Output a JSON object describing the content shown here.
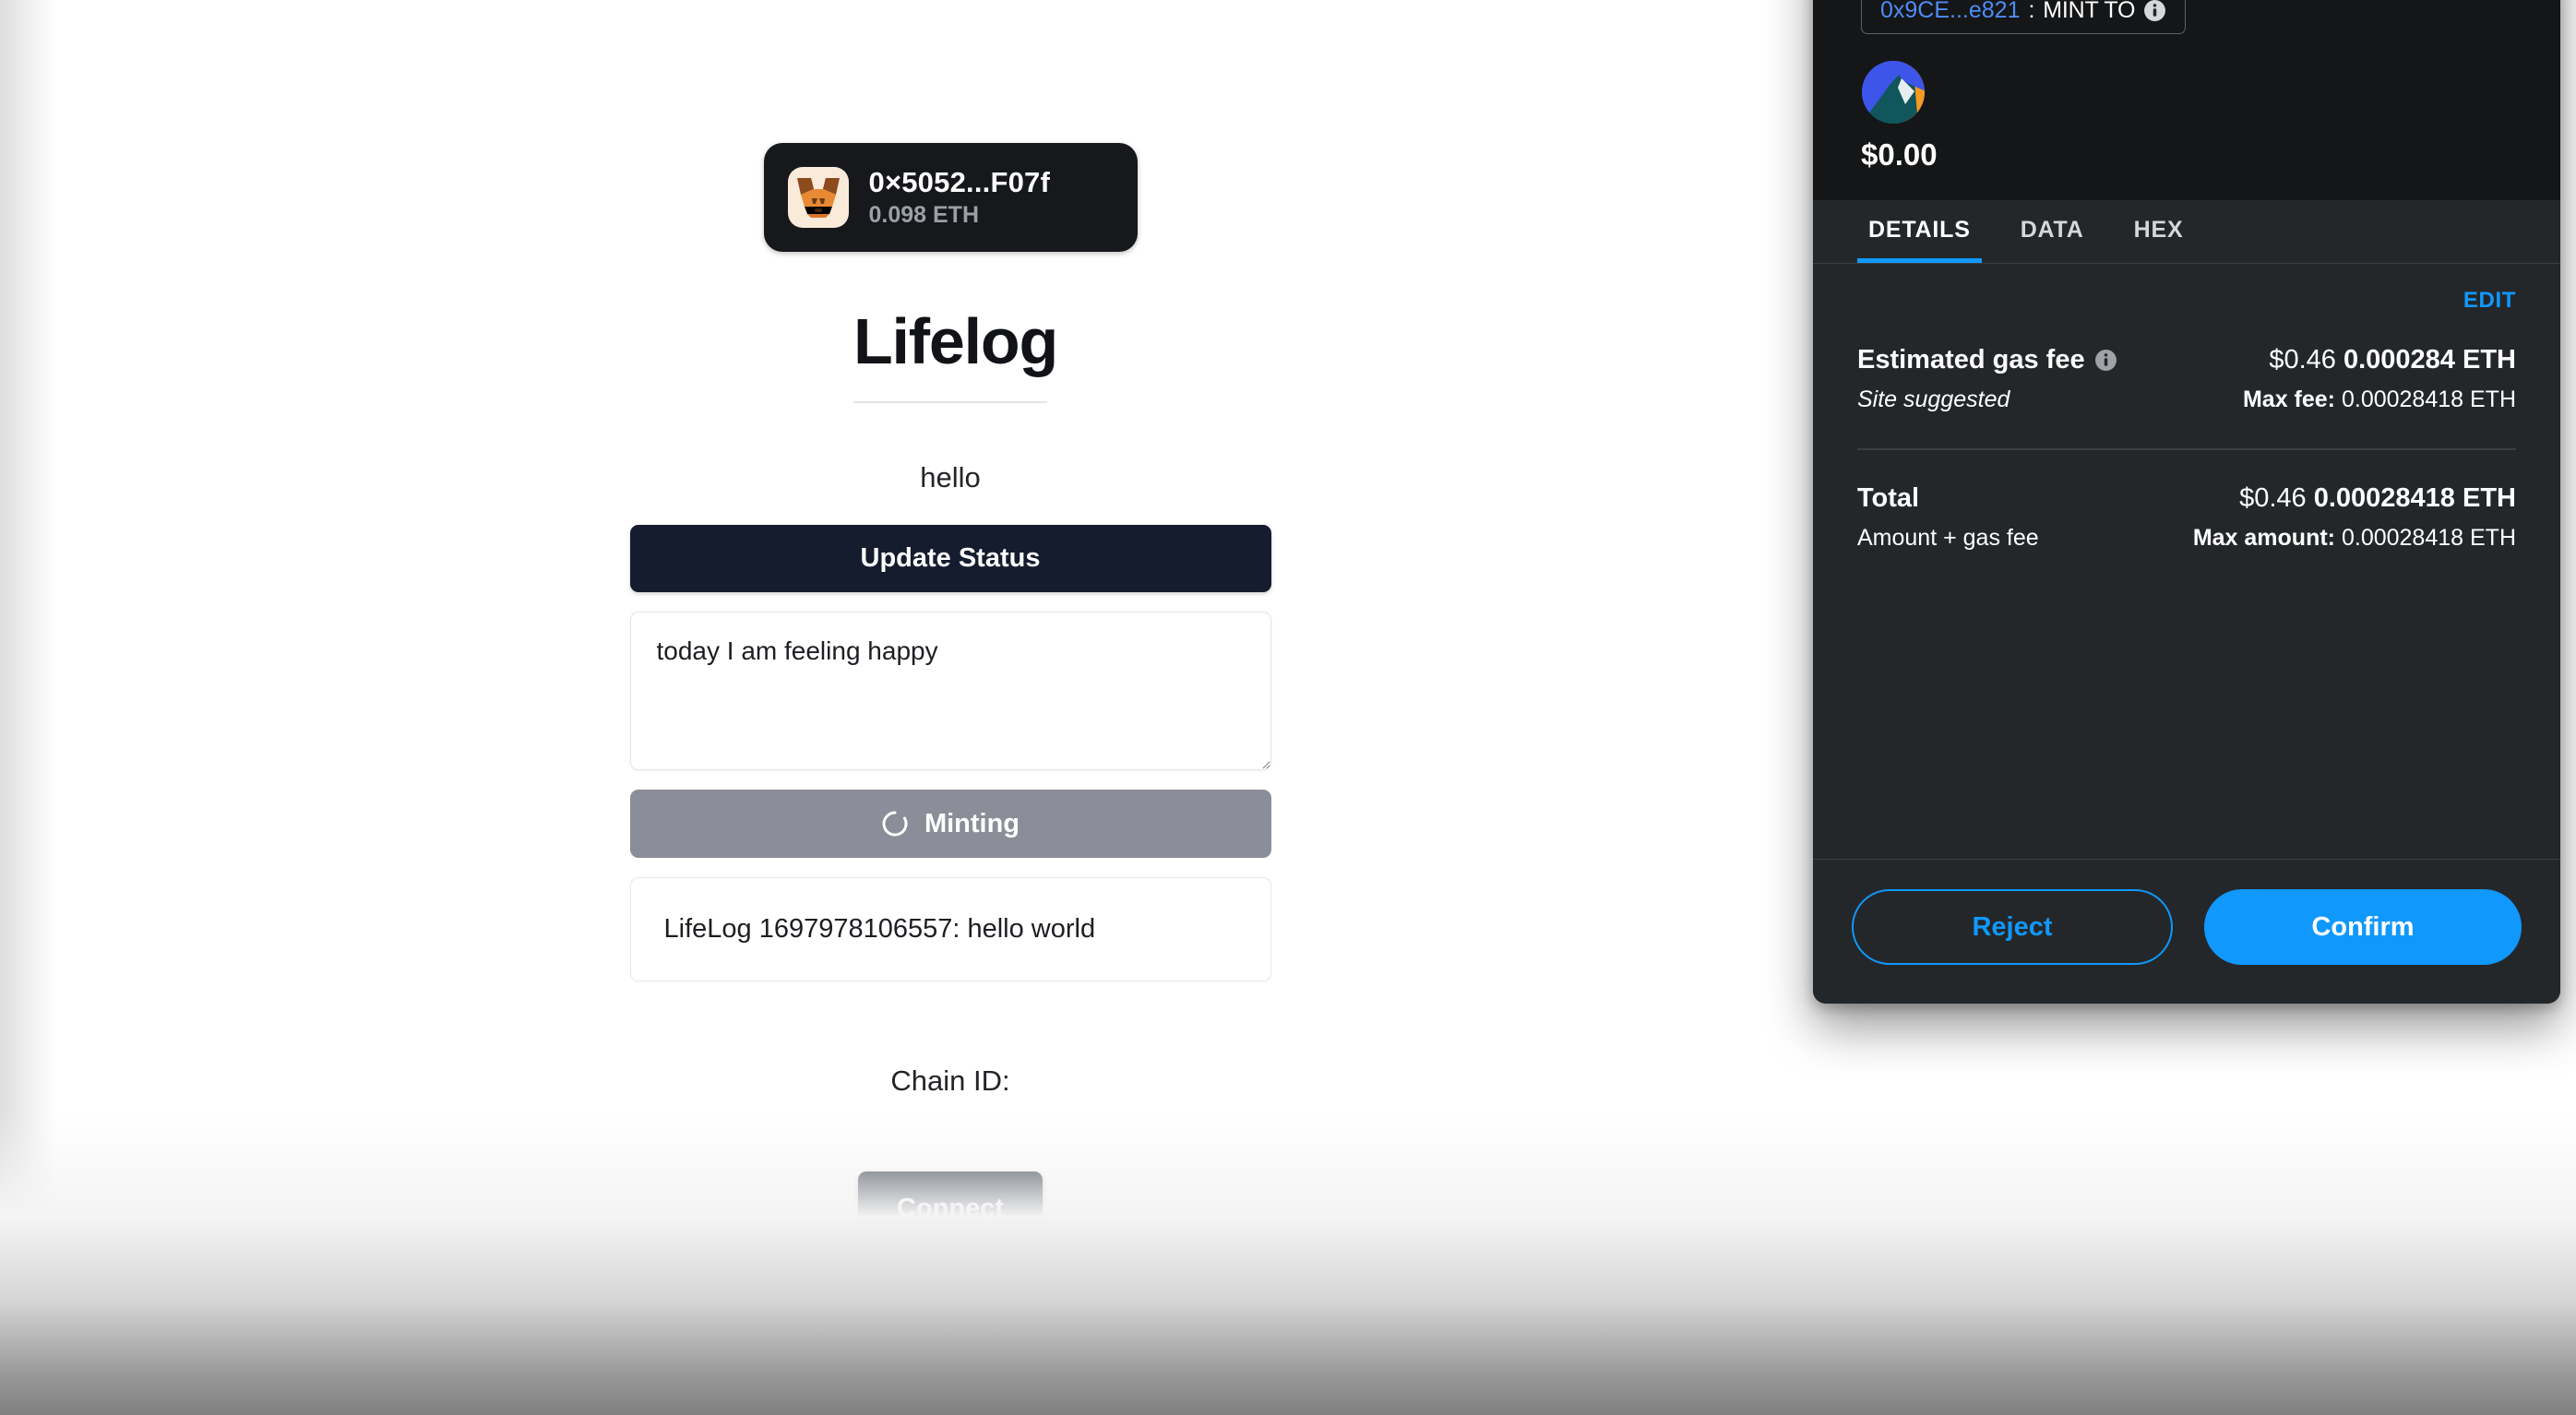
{
  "dapp": {
    "account": {
      "icon": "metamask-fox-icon",
      "address": "0×5052...F07f",
      "balance": "0.098 ETH"
    },
    "title": "Lifelog",
    "status_text": "hello",
    "update_button_label": "Update Status",
    "status_textarea_value": "today I am feeling happy",
    "status_textarea_placeholder": "",
    "minting_button_label": "Minting",
    "minting_spinner_icon": "spinner-icon",
    "log_entry": "LifeLog 1697978106557:  hello world",
    "chain_label": "Chain ID:",
    "chain_value": "",
    "connect_button_label": "Connect"
  },
  "metamask": {
    "header": {
      "mint_to_address": "0x9CE...e821",
      "mint_to_separator": " : ",
      "mint_to_label": "MINT TO",
      "mint_to_info_icon": "info-icon",
      "token_icon": "network-token-icon",
      "amount": "$0.00"
    },
    "tabs": [
      {
        "label": "DETAILS",
        "active": true
      },
      {
        "label": "DATA",
        "active": false
      },
      {
        "label": "HEX",
        "active": false
      }
    ],
    "details": {
      "edit_label": "EDIT",
      "gas": {
        "label": "Estimated gas fee",
        "info_icon": "info-icon",
        "fiat": "$0.46",
        "crypto": "0.000284 ETH",
        "sub_left": "Site suggested",
        "max_fee_label": "Max fee:",
        "max_fee_value": "0.00028418 ETH"
      },
      "total": {
        "label": "Total",
        "fiat": "$0.46",
        "crypto": "0.00028418 ETH",
        "sub_left": "Amount + gas fee",
        "max_amount_label": "Max amount:",
        "max_amount_value": "0.00028418 ETH"
      }
    },
    "footer": {
      "reject_label": "Reject",
      "confirm_label": "Confirm"
    }
  },
  "colors": {
    "accent_blue": "#1098fc",
    "dark_navy": "#151c2e",
    "panel_bg": "#24272a",
    "panel_head_bg": "#141618",
    "minting_grey": "#8b8e98"
  }
}
